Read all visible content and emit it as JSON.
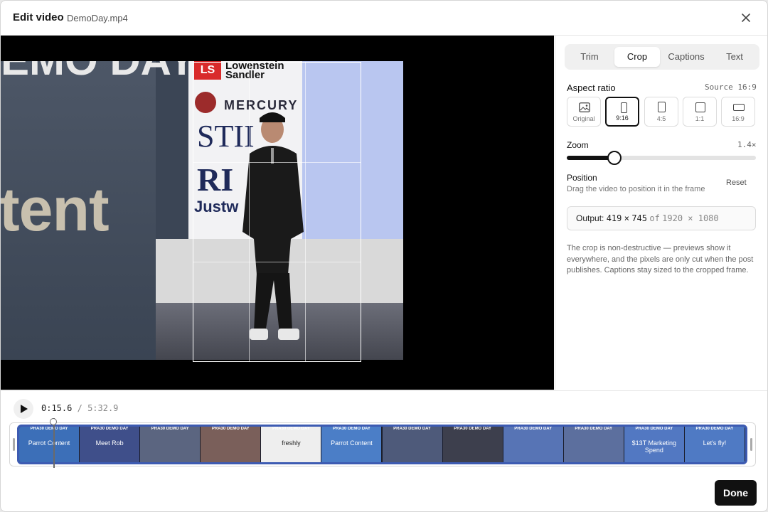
{
  "header": {
    "title": "Edit video",
    "filename": "DemoDay.mp4"
  },
  "video_text": {
    "top_band": "EMO DAY",
    "big_text": "tent",
    "logo_mark": "LS",
    "sponsor1": "Lowenstein Sandler",
    "sponsor2": "MERCURY",
    "sponsor3": "STII",
    "sponsor4": "RI",
    "sponsor5": "Justw"
  },
  "tabs": [
    {
      "label": "Trim",
      "active": false
    },
    {
      "label": "Crop",
      "active": true
    },
    {
      "label": "Captions",
      "active": false
    },
    {
      "label": "Text",
      "active": false
    }
  ],
  "aspect": {
    "label": "Aspect ratio",
    "source": "Source 16:9",
    "options": [
      {
        "label": "Original",
        "icon": "image-icon",
        "selected": false
      },
      {
        "label": "9:16",
        "icon": "portrait-icon",
        "selected": true
      },
      {
        "label": "4:5",
        "icon": "tall-rect-icon",
        "selected": false
      },
      {
        "label": "1:1",
        "icon": "square-icon",
        "selected": false
      },
      {
        "label": "16:9",
        "icon": "landscape-icon",
        "selected": false
      }
    ]
  },
  "zoom": {
    "label": "Zoom",
    "value": "1.4×",
    "level_fraction": 0.25
  },
  "position": {
    "label": "Position",
    "hint": "Drag the video to position it in the frame",
    "reset": "Reset"
  },
  "output": {
    "prefix": "Output:",
    "w": "419",
    "x": "×",
    "h": "745",
    "of": "of",
    "src": "1920 × 1080"
  },
  "note": "The crop is non-destructive — previews show it everywhere, and the pixels are only cut when the post publishes. Captions stay sized to the cropped frame.",
  "playback": {
    "current": "0:15.6",
    "sep": "/",
    "total": "5:32.9",
    "progress_fraction": 0.047
  },
  "timeline": {
    "frames": [
      {
        "caption": "PRA30 DEMO DAY",
        "text": "Parrot Content",
        "color": "#3c6fb8"
      },
      {
        "caption": "PRA30 DEMO DAY",
        "text": "Meet Rob",
        "color": "#3f4f8a"
      },
      {
        "caption": "PRA30 DEMO DAY",
        "text": "",
        "color": "#5b6580"
      },
      {
        "caption": "PRA30 DEMO DAY",
        "text": "",
        "color": "#7a5f5a"
      },
      {
        "caption": "PRA30 DEMO DAY",
        "text": "freshly",
        "color": "#eeeeee"
      },
      {
        "caption": "PRA30 DEMO DAY",
        "text": "Parrot Content",
        "color": "#4b7ec7"
      },
      {
        "caption": "PRA30 DEMO DAY",
        "text": "",
        "color": "#4e5a7a"
      },
      {
        "caption": "PRA30 DEMO DAY",
        "text": "",
        "color": "#3d3f4d"
      },
      {
        "caption": "PRA30 DEMO DAY",
        "text": "",
        "color": "#5774b5"
      },
      {
        "caption": "PRA30 DEMO DAY",
        "text": "",
        "color": "#5c6f9e"
      },
      {
        "caption": "PRA30 DEMO DAY",
        "text": "$13T Marketing Spend",
        "color": "#5278c2"
      },
      {
        "caption": "PRA30 DEMO DAY",
        "text": "Let's fly!",
        "color": "#4f7ac4"
      }
    ]
  },
  "done": "Done",
  "colors": {
    "accent": "#111111",
    "timeline_border": "#3d5bb2"
  }
}
